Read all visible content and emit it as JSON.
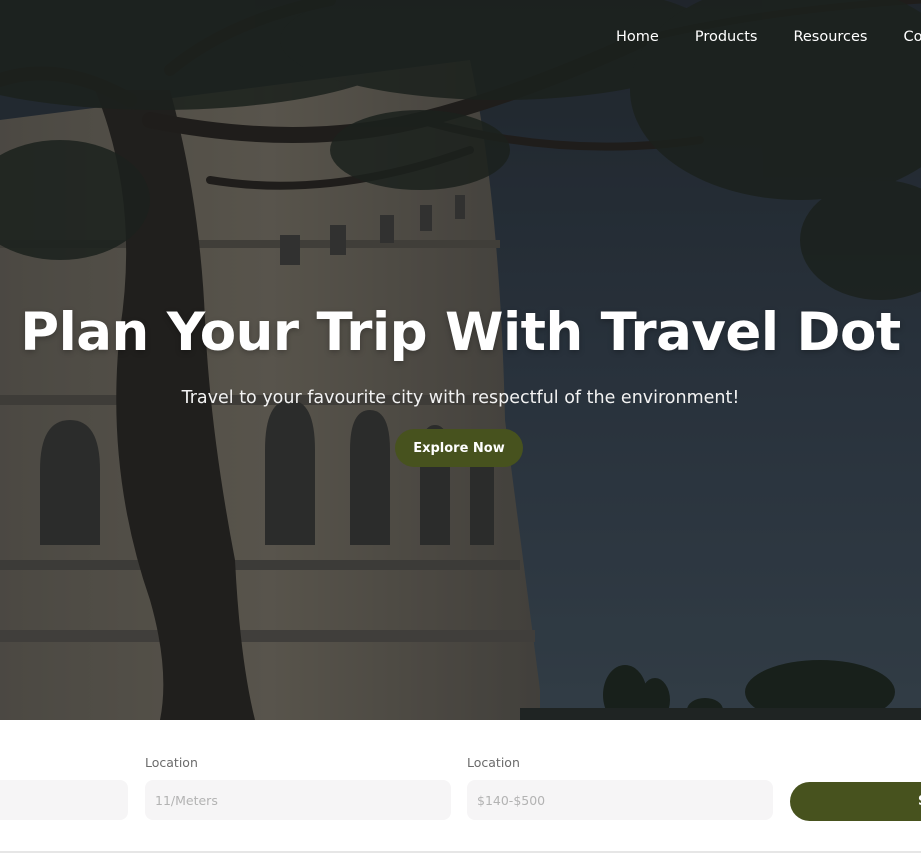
{
  "nav": {
    "items": [
      "Home",
      "Products",
      "Resources",
      "Co"
    ]
  },
  "hero": {
    "title": "Plan Your Trip With Travel Dot",
    "subtitle": "Travel to your favourite city with respectful of the environment!",
    "cta_label": "Explore Now"
  },
  "search": {
    "fields": [
      {
        "label": "Location",
        "placeholder": "11/Meters"
      },
      {
        "label": "Location",
        "placeholder": "$140-$500"
      }
    ],
    "submit_label": "S"
  },
  "colors": {
    "accent": "#47521e",
    "input_bg": "#f6f5f6",
    "sky": "#394554"
  },
  "icons": []
}
